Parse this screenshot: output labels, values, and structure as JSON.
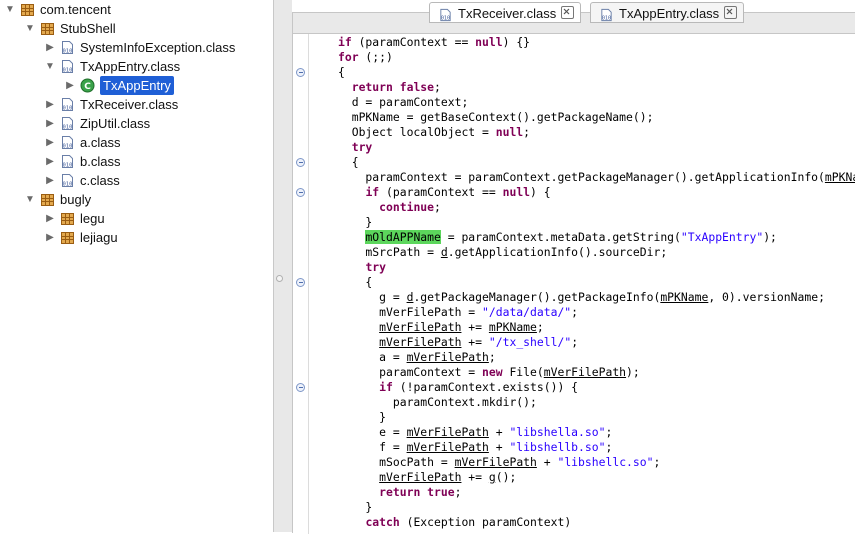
{
  "tree": {
    "items": [
      {
        "label": "com.tencent",
        "twisty": "open",
        "icon": "package-icon"
      },
      {
        "label": "StubShell",
        "twisty": "open",
        "icon": "package-icon"
      },
      {
        "label": "SystemInfoException.class",
        "twisty": "closed",
        "icon": "class-file-icon"
      },
      {
        "label": "TxAppEntry.class",
        "twisty": "open",
        "icon": "class-file-icon"
      },
      {
        "label": "TxAppEntry",
        "twisty": "closed",
        "icon": "class-icon",
        "selected": true
      },
      {
        "label": "TxReceiver.class",
        "twisty": "closed",
        "icon": "class-file-icon"
      },
      {
        "label": "ZipUtil.class",
        "twisty": "closed",
        "icon": "class-file-icon"
      },
      {
        "label": "a.class",
        "twisty": "closed",
        "icon": "class-file-icon"
      },
      {
        "label": "b.class",
        "twisty": "closed",
        "icon": "class-file-icon"
      },
      {
        "label": "c.class",
        "twisty": "closed",
        "icon": "class-file-icon"
      },
      {
        "label": "bugly",
        "twisty": "open",
        "icon": "package-icon"
      },
      {
        "label": "legu",
        "twisty": "closed",
        "icon": "package-icon"
      },
      {
        "label": "lejiagu",
        "twisty": "closed",
        "icon": "package-icon"
      }
    ]
  },
  "tabs": [
    {
      "label": "TxReceiver.class",
      "active": true
    },
    {
      "label": "TxAppEntry.class",
      "active": false
    }
  ],
  "code": {
    "lines": [
      [
        [
          "kw",
          "if"
        ],
        [
          "t",
          " (paramContext == "
        ],
        [
          "kw",
          "null"
        ],
        [
          "t",
          ") {}"
        ]
      ],
      [
        [
          "kw",
          "for"
        ],
        [
          "t",
          " (;;)"
        ]
      ],
      [
        [
          "t",
          "{"
        ]
      ],
      [
        [
          "t",
          "  "
        ],
        [
          "kw",
          "return"
        ],
        [
          "t",
          " "
        ],
        [
          "kw",
          "false"
        ],
        [
          "t",
          ";"
        ]
      ],
      [
        [
          "t",
          "  d = paramContext;"
        ]
      ],
      [
        [
          "t",
          "  mPKName = getBaseContext().getPackageName();"
        ]
      ],
      [
        [
          "t",
          "  Object localObject = "
        ],
        [
          "kw",
          "null"
        ],
        [
          "t",
          ";"
        ]
      ],
      [
        [
          "t",
          "  "
        ],
        [
          "kw",
          "try"
        ]
      ],
      [
        [
          "t",
          "  {"
        ]
      ],
      [
        [
          "t",
          "    paramContext = paramContext.getPackageManager().getApplicationInfo("
        ],
        [
          "f",
          "mPKName"
        ]
      ],
      [
        [
          "t",
          "    "
        ],
        [
          "kw",
          "if"
        ],
        [
          "t",
          " (paramContext == "
        ],
        [
          "kw",
          "null"
        ],
        [
          "t",
          ") {"
        ]
      ],
      [
        [
          "t",
          "      "
        ],
        [
          "kw",
          "continue"
        ],
        [
          "t",
          ";"
        ]
      ],
      [
        [
          "t",
          "    }"
        ]
      ],
      [
        [
          "t",
          "    "
        ],
        [
          "h",
          "mOldAPPName"
        ],
        [
          "t",
          " = paramContext.metaData.getString("
        ],
        [
          "s",
          "\"TxAppEntry\""
        ],
        [
          "t",
          ");"
        ]
      ],
      [
        [
          "t",
          "    mSrcPath = "
        ],
        [
          "f",
          "d"
        ],
        [
          "t",
          ".getApplicationInfo().sourceDir;"
        ]
      ],
      [
        [
          "t",
          "    "
        ],
        [
          "kw",
          "try"
        ]
      ],
      [
        [
          "t",
          "    {"
        ]
      ],
      [
        [
          "t",
          "      g = "
        ],
        [
          "f",
          "d"
        ],
        [
          "t",
          ".getPackageManager().getPackageInfo("
        ],
        [
          "f",
          "mPKName"
        ],
        [
          "t",
          ", 0).versionName;"
        ]
      ],
      [
        [
          "t",
          "      mVerFilePath = "
        ],
        [
          "s",
          "\"/data/data/\""
        ],
        [
          "t",
          ";"
        ]
      ],
      [
        [
          "t",
          "      "
        ],
        [
          "f",
          "mVerFilePath"
        ],
        [
          "t",
          " += "
        ],
        [
          "f",
          "mPKName"
        ],
        [
          "t",
          ";"
        ]
      ],
      [
        [
          "t",
          "      "
        ],
        [
          "f",
          "mVerFilePath"
        ],
        [
          "t",
          " += "
        ],
        [
          "s",
          "\"/tx_shell/\""
        ],
        [
          "t",
          ";"
        ]
      ],
      [
        [
          "t",
          "      a = "
        ],
        [
          "f",
          "mVerFilePath"
        ],
        [
          "t",
          ";"
        ]
      ],
      [
        [
          "t",
          "      paramContext = "
        ],
        [
          "kw",
          "new"
        ],
        [
          "t",
          " File("
        ],
        [
          "f",
          "mVerFilePath"
        ],
        [
          "t",
          ");"
        ]
      ],
      [
        [
          "t",
          "      "
        ],
        [
          "kw",
          "if"
        ],
        [
          "t",
          " (!paramContext.exists()) {"
        ]
      ],
      [
        [
          "t",
          "        paramContext.mkdir();"
        ]
      ],
      [
        [
          "t",
          "      }"
        ]
      ],
      [
        [
          "t",
          "      e = "
        ],
        [
          "f",
          "mVerFilePath"
        ],
        [
          "t",
          " + "
        ],
        [
          "s",
          "\"libshella.so\""
        ],
        [
          "t",
          ";"
        ]
      ],
      [
        [
          "t",
          "      f = "
        ],
        [
          "f",
          "mVerFilePath"
        ],
        [
          "t",
          " + "
        ],
        [
          "s",
          "\"libshellb.so\""
        ],
        [
          "t",
          ";"
        ]
      ],
      [
        [
          "t",
          "      mSocPath = "
        ],
        [
          "f",
          "mVerFilePath"
        ],
        [
          "t",
          " + "
        ],
        [
          "s",
          "\"libshellc.so\""
        ],
        [
          "t",
          ";"
        ]
      ],
      [
        [
          "t",
          "      "
        ],
        [
          "f",
          "mVerFilePath"
        ],
        [
          "t",
          " += "
        ],
        [
          "f",
          "g"
        ],
        [
          "t",
          "();"
        ]
      ],
      [
        [
          "t",
          "      "
        ],
        [
          "kw",
          "return"
        ],
        [
          "t",
          " "
        ],
        [
          "kw",
          "true"
        ],
        [
          "t",
          ";"
        ]
      ],
      [
        [
          "t",
          "    }"
        ]
      ],
      [
        [
          "t",
          "    "
        ],
        [
          "kw",
          "catch"
        ],
        [
          "t",
          " (Exception paramContext)"
        ]
      ]
    ]
  },
  "colors": {
    "keyword": "#7f0055",
    "string": "#2a00ff",
    "highlight": "#5cd65c",
    "selection": "#1f5fd6"
  }
}
